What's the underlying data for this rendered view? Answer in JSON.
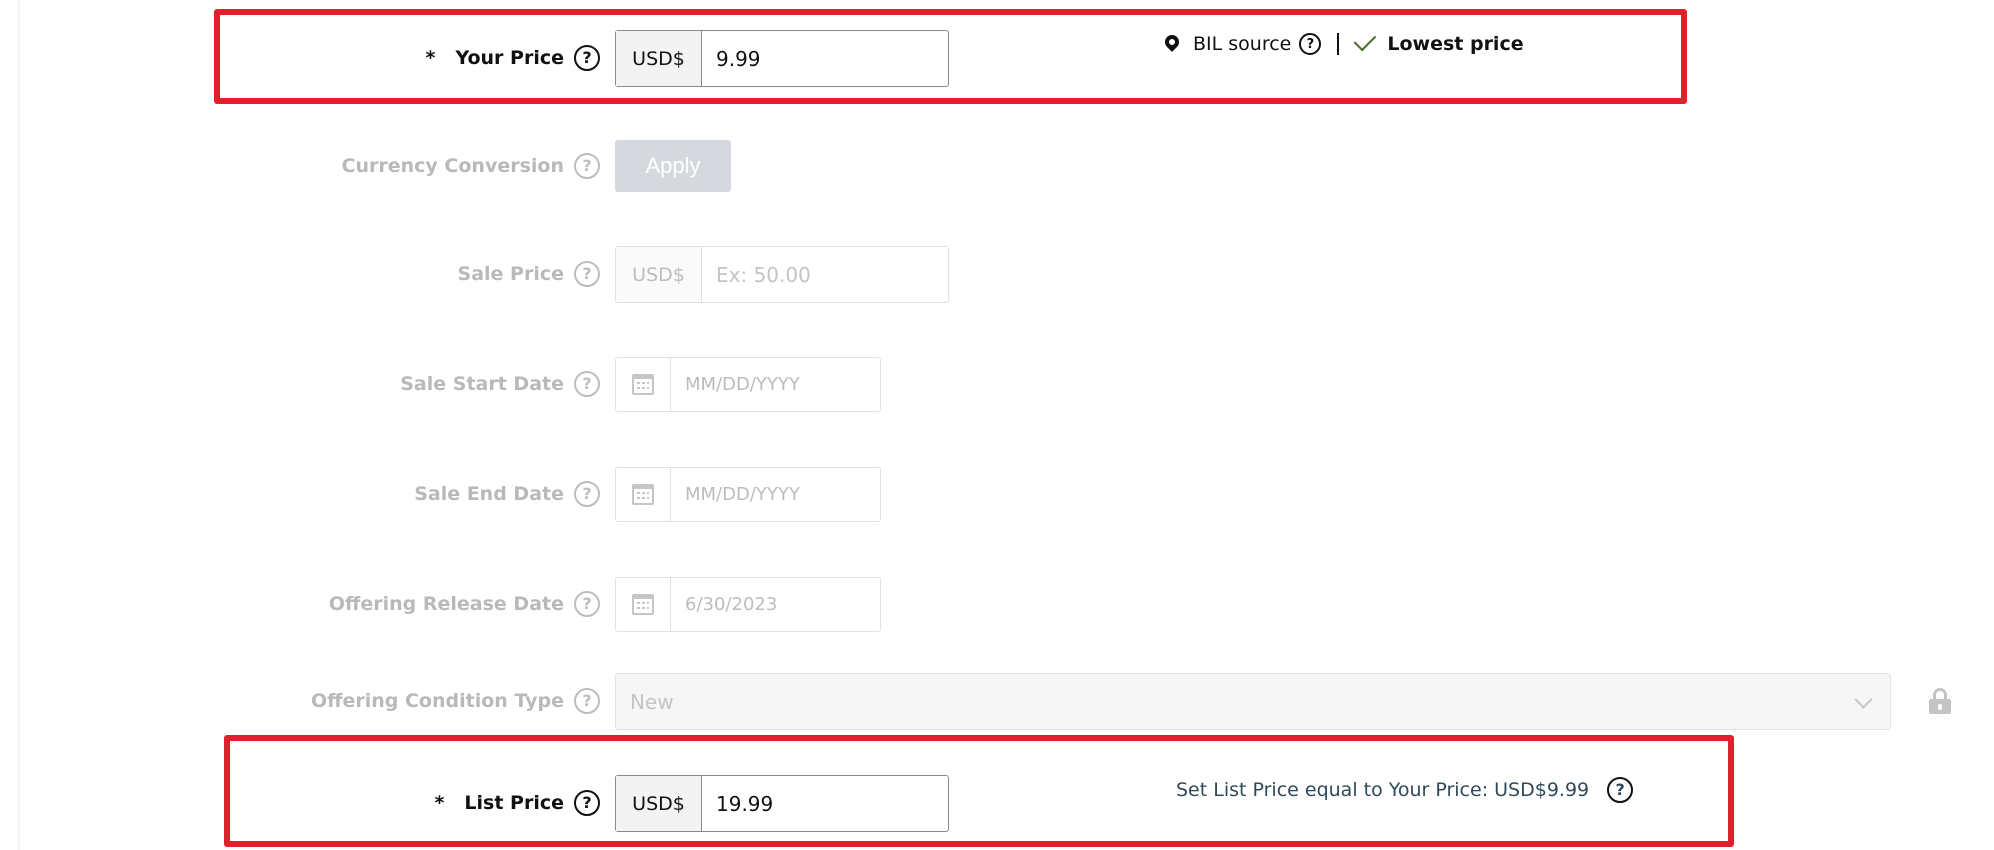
{
  "your_price": {
    "required_mark": "*",
    "label": "Your Price",
    "currency": "USD$",
    "value": "9.99",
    "bil_source_label": "BIL source",
    "lowest_price_label": "Lowest price"
  },
  "currency_conversion": {
    "label": "Currency Conversion",
    "apply_label": "Apply"
  },
  "sale_price": {
    "label": "Sale Price",
    "currency": "USD$",
    "placeholder": "Ex: 50.00"
  },
  "sale_start_date": {
    "label": "Sale Start Date",
    "placeholder": "MM/DD/YYYY"
  },
  "sale_end_date": {
    "label": "Sale End Date",
    "placeholder": "MM/DD/YYYY"
  },
  "offering_release_date": {
    "label": "Offering Release Date",
    "value": "6/30/2023"
  },
  "offering_condition_type": {
    "label": "Offering Condition Type",
    "selected": "New"
  },
  "list_price": {
    "required_mark": "*",
    "label": "List Price",
    "currency": "USD$",
    "value": "19.99",
    "set_equal_label": "Set List Price equal to Your Price: USD$9.99"
  },
  "colors": {
    "highlight": "#e0202b",
    "check": "#4d6b2e",
    "link_text": "#2e4a59"
  }
}
